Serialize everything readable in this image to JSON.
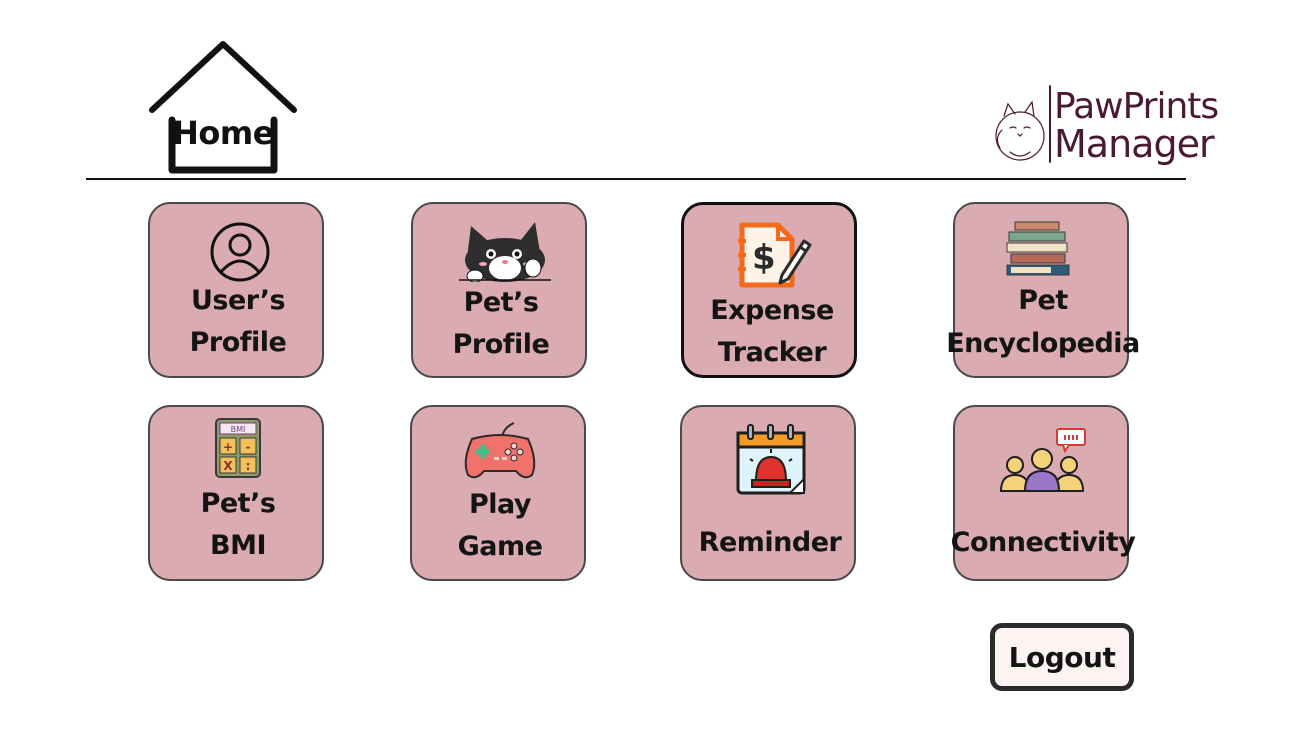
{
  "header": {
    "home_label": "Home",
    "brand_name": "PawPrints",
    "brand_sub": "Manager"
  },
  "tiles": [
    {
      "line1": "User’s",
      "line2": "Profile",
      "icon": "user-circle-icon"
    },
    {
      "line1": "Pet’s",
      "line2": "Profile",
      "icon": "cat-icon"
    },
    {
      "line1": "Expense",
      "line2": "Tracker",
      "icon": "expense-notebook-icon"
    },
    {
      "line1": "Pet",
      "line2": "Encyclopedia",
      "icon": "books-icon"
    },
    {
      "line1": "Pet’s",
      "line2": "BMI",
      "icon": "calculator-icon"
    },
    {
      "line1": "Play",
      "line2": "Game",
      "icon": "gamepad-icon"
    },
    {
      "line1": "Reminder",
      "icon": "calendar-alarm-icon"
    },
    {
      "line1": "Connectivity",
      "icon": "people-chat-icon"
    }
  ],
  "calculator": {
    "screen_text": "BMI",
    "keys": [
      "+",
      "-",
      "X",
      ":"
    ]
  },
  "logout_label": "Logout",
  "colors": {
    "tile_bg": "#dbabb2",
    "brand": "#4a1a33",
    "logout_bg": "#fdf3f3"
  }
}
